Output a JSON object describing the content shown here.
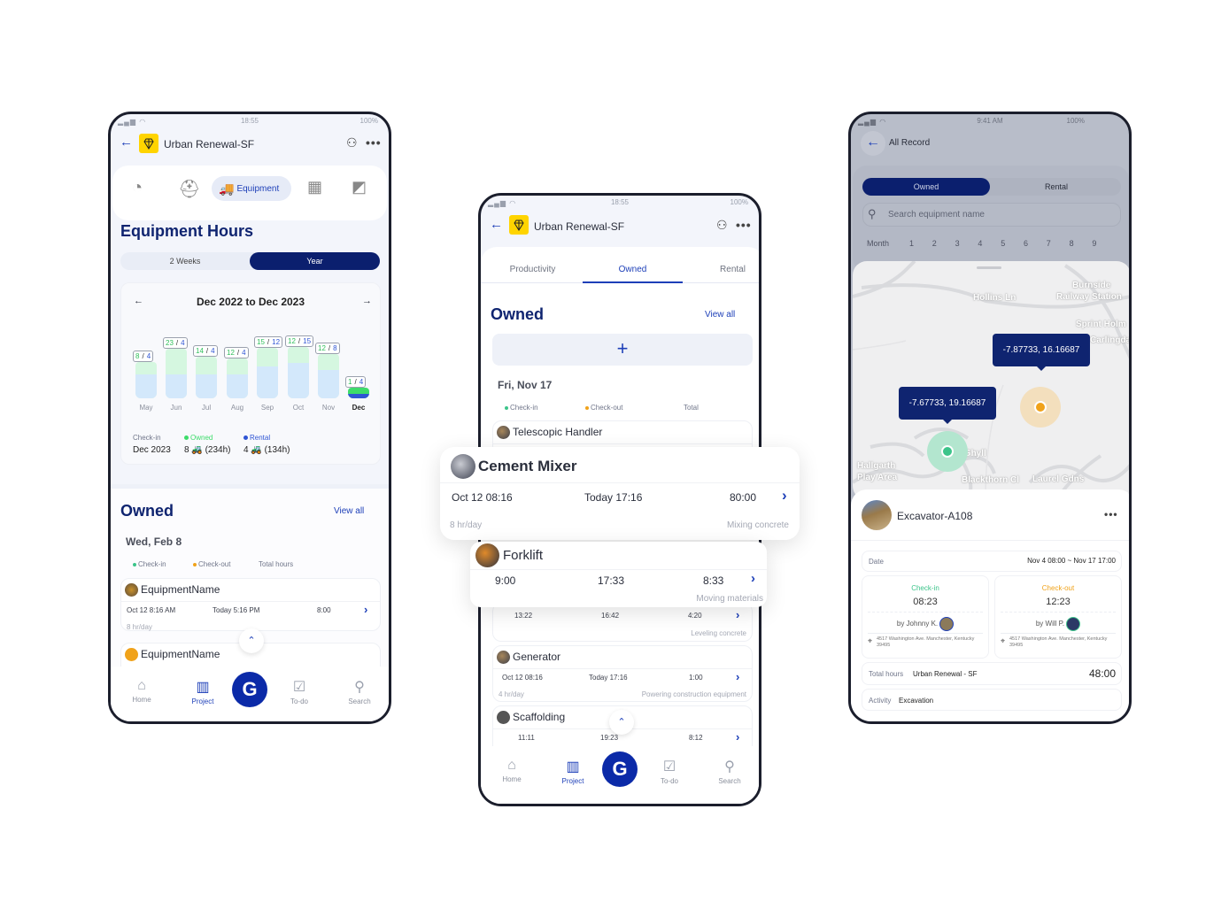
{
  "colors": {
    "primary": "#0f2470",
    "accent": "#1d3fb8",
    "owned": "#3ddc6a",
    "rental": "#2f55d4",
    "checkin": "#3cc48a",
    "checkout": "#f0a21a",
    "logo": "#ffd400"
  },
  "left_phone": {
    "status": {
      "time": "18:55",
      "battery": "100%"
    },
    "header": {
      "title": "Urban Renewal-SF",
      "back_icon": "arrow-left",
      "add_user_icon": "user-plus",
      "more_icon": "more-horizontal"
    },
    "icon_tabs": {
      "items": [
        "speedometer",
        "worker-helmet",
        "Equipment",
        "budget-calculator",
        "blueprint"
      ],
      "active_label": "Equipment"
    },
    "equipment_hours": {
      "title": "Equipment Hours",
      "segments": [
        "2 Weeks",
        "Year"
      ],
      "active_segment": "Year",
      "range": "Dec 2022 to Dec 2023",
      "legend": {
        "checkin_label": "Check-in",
        "checkin_value": "Dec 2023",
        "owned_label": "Owned",
        "owned_value": "8 🚜 (234h)",
        "rental_label": "Rental",
        "rental_value": "4 🚜 (134h)"
      }
    },
    "owned": {
      "title": "Owned",
      "view_all": "View all",
      "date": "Wed, Feb 8",
      "columns": [
        "Check-in",
        "Check-out",
        "Total hours"
      ],
      "items": [
        {
          "name": "EquipmentName",
          "checkin": "Oct 12 8:16 AM",
          "checkout": "Today 5:16 PM",
          "total": "8:00",
          "rate": "8 hr/day"
        },
        {
          "name": "EquipmentName"
        }
      ]
    },
    "nav": {
      "items": [
        "Home",
        "Project",
        "To-do",
        "Search"
      ],
      "active": "Project",
      "center_logo": "G"
    }
  },
  "chart_data": {
    "type": "bar",
    "categories": [
      "May",
      "Jun",
      "Jul",
      "Aug",
      "Sep",
      "Oct",
      "Nov",
      "Dec"
    ],
    "series": [
      {
        "name": "Owned",
        "values": [
          8,
          23,
          14,
          12,
          15,
          12,
          12,
          1
        ]
      },
      {
        "name": "Rental",
        "values": [
          4,
          4,
          4,
          4,
          12,
          15,
          8,
          4
        ]
      }
    ],
    "highlighted": "Dec",
    "stacked": true
  },
  "middle_phone": {
    "status": {
      "time": "18:55",
      "battery": "100%"
    },
    "header": {
      "title": "Urban Renewal-SF"
    },
    "tabs": [
      "Productivity",
      "Owned",
      "Rental"
    ],
    "active_tab": "Owned",
    "owned": {
      "title": "Owned",
      "view_all": "View all",
      "add": "+",
      "date": "Fri, Nov 17",
      "columns": [
        "Check-in",
        "Check-out",
        "Total"
      ]
    },
    "items": [
      {
        "name": "Telescopic Handler"
      },
      {
        "checkin": "13:22",
        "checkout": "16:42",
        "total": "4:20",
        "activity": "Leveling concrete"
      },
      {
        "name": "Generator",
        "checkin": "Oct 12 08:16",
        "checkout": "Today 17:16",
        "total": "1:00",
        "rate": "4 hr/day",
        "activity": "Powering construction equipment"
      },
      {
        "name": "Scaffolding",
        "checkin": "11:11",
        "checkout": "19:23",
        "total": "8:12"
      }
    ],
    "nav": {
      "items": [
        "Home",
        "Project",
        "To-do",
        "Search"
      ],
      "active": "Project",
      "center_logo": "G"
    }
  },
  "floating_cards": [
    {
      "name": "Cement Mixer",
      "checkin": "Oct 12 08:16",
      "checkout": "Today 17:16",
      "total": "80:00",
      "rate": "8 hr/day",
      "activity": "Mixing concrete"
    },
    {
      "name": "Forklift",
      "checkin": "9:00",
      "checkout": "17:33",
      "total": "8:33",
      "activity": "Moving materials"
    }
  ],
  "right_phone": {
    "status": {
      "time": "9:41 AM",
      "battery": "100%"
    },
    "header": {
      "title": "All Record"
    },
    "segments": [
      "Owned",
      "Rental"
    ],
    "active_segment": "Owned",
    "search_placeholder": "Search equipment name",
    "month_label": "Month",
    "months": [
      "1",
      "2",
      "3",
      "4",
      "5",
      "6",
      "7",
      "8",
      "9"
    ],
    "map": {
      "labels": [
        "Hollins Ln",
        "Burnside",
        "Railway Station",
        "Sprint Holm",
        "Carlingdale",
        "Mass Ghyll",
        "Hallgarth",
        "Play Area",
        "Blackthorn Cl",
        "Laurel Gdns"
      ],
      "markers": [
        {
          "coords": "-7.87733, 16.16687",
          "status": "checkout"
        },
        {
          "coords": "-7.67733, 19.16687",
          "status": "checkin"
        }
      ]
    },
    "detail": {
      "name": "Excavator-A108",
      "date_label": "Date",
      "date_value": "Nov 4 08:00 ~ Nov 17 17:00",
      "checkin": {
        "label": "Check-in",
        "time": "08:23",
        "by": "by Johnny K.",
        "address": "4517 Washington Ave. Manchester, Kentucky 39495"
      },
      "checkout": {
        "label": "Check-out",
        "time": "12:23",
        "by": "by Will P.",
        "address": "4517 Washington Ave. Manchester, Kentucky 39495"
      },
      "total_label": "Total hours",
      "project": "Urban Renewal - SF",
      "total_value": "48:00",
      "activity_label": "Activity",
      "activity_value": "Excavation"
    }
  }
}
